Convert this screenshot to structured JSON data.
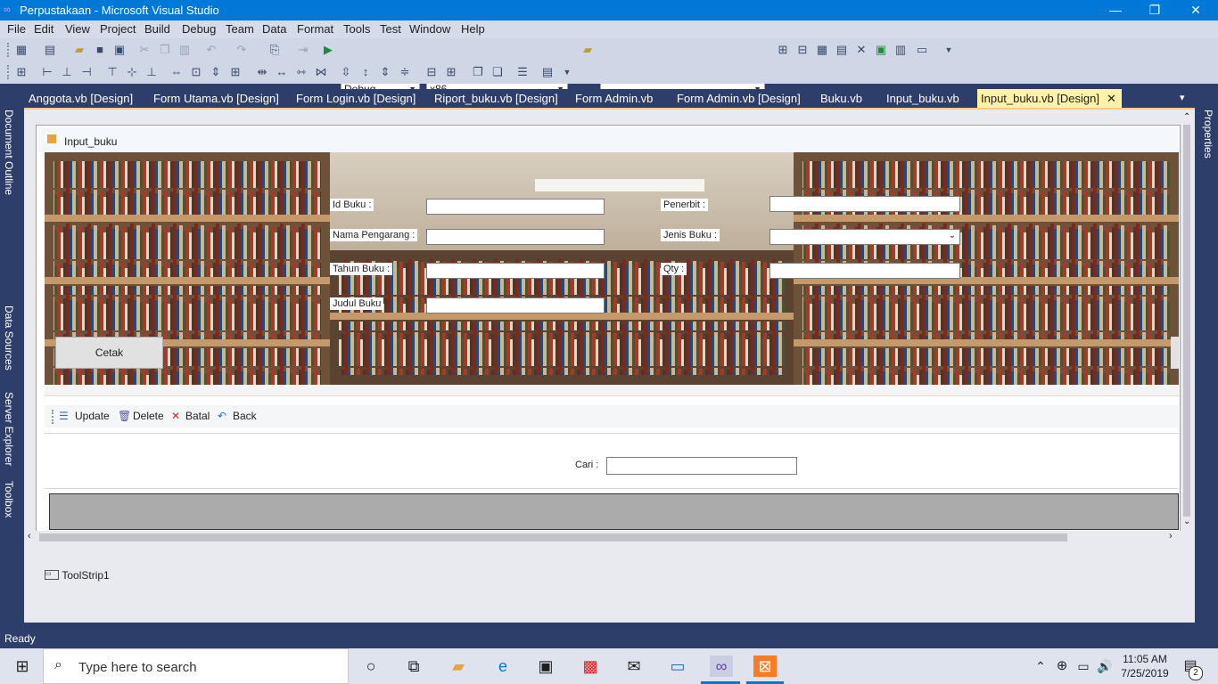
{
  "window": {
    "title": "Perpustakaan - Microsoft Visual Studio",
    "minimize": "—",
    "restore": "❐",
    "close": "✕"
  },
  "menu": [
    "File",
    "Edit",
    "View",
    "Project",
    "Build",
    "Debug",
    "Team",
    "Data",
    "Format",
    "Tools",
    "Test",
    "Window",
    "Help"
  ],
  "toolbar": {
    "config": "Debug",
    "platform": "x86",
    "find_value": ""
  },
  "tabs": [
    "Anggota.vb [Design]",
    "Form Utama.vb [Design]",
    "Form Login.vb [Design]",
    "Riport_buku.vb [Design]",
    "Form Admin.vb",
    "Form Admin.vb [Design]",
    "Buku.vb",
    "Input_buku.vb",
    "Input_buku.vb [Design]"
  ],
  "side_left": [
    "Document Outline",
    "Data Sources",
    "Server Explorer",
    "Toolbox"
  ],
  "side_right": [
    "Properties"
  ],
  "form": {
    "title": "Input_buku",
    "labels": {
      "id_buku": "Id Buku :",
      "nama_pengarang": "Nama Pengarang :",
      "tahun_buku": "Tahun Buku :",
      "judul_buku": "Judul Buku",
      "penerbit": "Penerbit :",
      "jenis_buku": "Jenis Buku :",
      "qty": "Qty :",
      "cari": "Cari :"
    },
    "buttons": {
      "cetak": "Cetak"
    },
    "toolstrip": {
      "update": "Update",
      "delete": "Delete",
      "batal": "Batal",
      "back": "Back"
    }
  },
  "component_tray": {
    "toolstrip": "ToolStrip1"
  },
  "status": {
    "text": "Ready"
  },
  "taskbar": {
    "search_placeholder": "Type here to search",
    "time": "11:05 AM",
    "date": "7/25/2019",
    "notifications": "2"
  },
  "colors": {
    "accent": "#0078d7",
    "vs_dark": "#2d3e6b",
    "active_tab": "#fff1a8"
  }
}
